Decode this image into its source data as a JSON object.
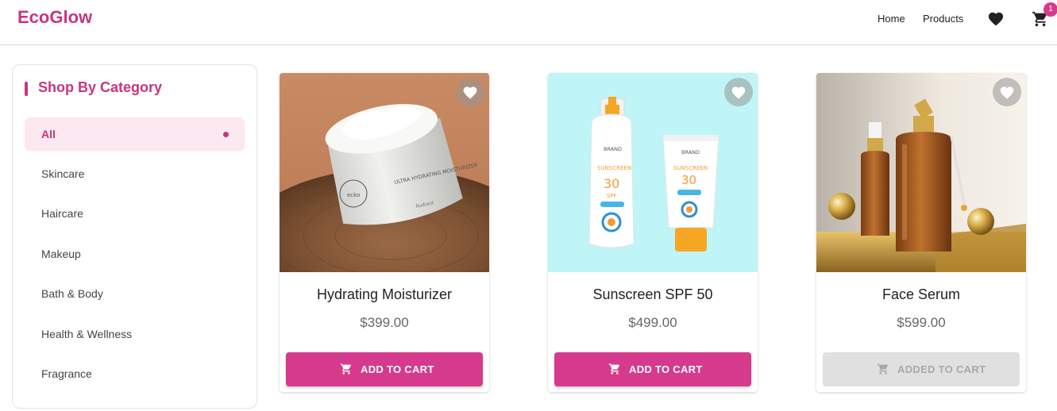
{
  "brand": {
    "name": "EcoGlow",
    "color": "#c8347e"
  },
  "nav": {
    "home": "Home",
    "products": "Products",
    "cart_count": "1"
  },
  "sidebar": {
    "title": "Shop By Category",
    "categories": [
      {
        "label": "All",
        "active": true
      },
      {
        "label": "Skincare",
        "active": false
      },
      {
        "label": "Haircare",
        "active": false
      },
      {
        "label": "Makeup",
        "active": false
      },
      {
        "label": "Bath & Body",
        "active": false
      },
      {
        "label": "Health & Wellness",
        "active": false
      },
      {
        "label": "Fragrance",
        "active": false
      }
    ]
  },
  "products": [
    {
      "name": "Hydrating Moisturizer",
      "price": "$399.00",
      "button": "ADD TO CART",
      "added": false,
      "image": {
        "jar_label": "ULTRA HYDRATING MOISTURIZER",
        "jar_brand": "ecko",
        "jar_sub": "Rudiant"
      }
    },
    {
      "name": "Sunscreen SPF 50",
      "price": "$499.00",
      "button": "ADD TO CART",
      "added": false,
      "image": {
        "brand": "BRAND",
        "label": "SUNSCREEN",
        "spf": "30",
        "spf_unit": "SPF"
      }
    },
    {
      "name": "Face Serum",
      "price": "$599.00",
      "button": "ADDED TO CART",
      "added": true
    }
  ],
  "colors": {
    "accent": "#d63a8c",
    "active_bg": "#fbe8f1",
    "disabled_bg": "#e0e0e0"
  }
}
